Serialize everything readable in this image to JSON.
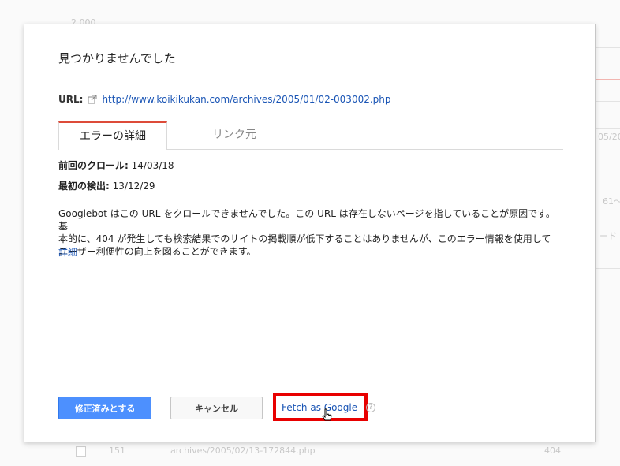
{
  "background": {
    "top_value": "2,000",
    "date_label": "05/20",
    "range_label": "61〜",
    "side_label": "ード",
    "row": {
      "index": "151",
      "url": "archives/2005/02/13-172844.php",
      "code": "404"
    }
  },
  "dialog": {
    "title": "見つかりませんでした",
    "url_label": "URL:",
    "url_icon": "external-link-icon",
    "url": "http://www.koikikukan.com/archives/2005/01/02-003002.php",
    "tabs": [
      {
        "label": "エラーの詳細",
        "active": true
      },
      {
        "label": "リンク元",
        "active": false
      }
    ],
    "last_crawl_label": "前回のクロール:",
    "last_crawl_value": "14/03/18",
    "first_detected_label": "最初の検出:",
    "first_detected_value": "13/12/29",
    "description_lines": [
      "Googlebot はこの URL をクロールできませんでした。この URL は存在しないページを指していることが原因です。基",
      "本的に、404 が発生しても検索結果でのサイトの掲載順が低下することはありませんが、このエラー情報を使用して",
      "ユーザー利便性の向上を図ることができます。"
    ],
    "details_link": "詳細",
    "buttons": {
      "mark_fixed": "修正済みとする",
      "cancel": "キャンセル",
      "fetch_as_google": "Fetch as Google",
      "help": "?"
    },
    "colors": {
      "primary_button": "#4d90fe",
      "link": "#1a55b5",
      "tab_accent": "#dd4b39",
      "highlight_box": "#e80000"
    }
  }
}
